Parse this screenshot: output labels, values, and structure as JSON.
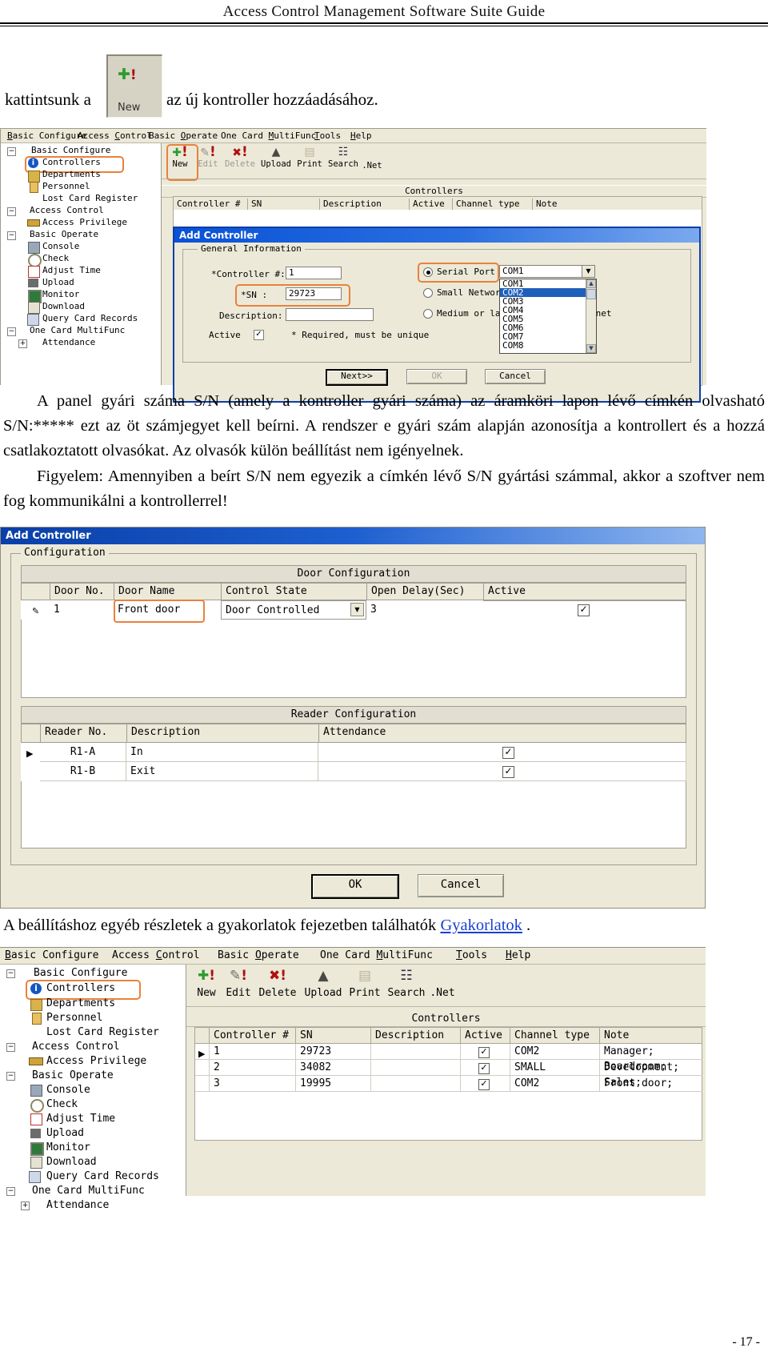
{
  "document": {
    "running_head": "Access Control Management Software Suite Guide",
    "page_number": "- 17 -"
  },
  "intro": {
    "before": "kattintsunk a",
    "after": "az új kontroller hozzáadásához.",
    "button_label": "New",
    "button_icon": "add-plus-icon"
  },
  "paragraphs": {
    "p1": "A panel gyári száma S/N (amely a kontroller gyári száma) az áramköri lapon lévő címkén olvasható S/N:***** ezt az öt számjegyet kell beírni. A rendszer e gyári szám alapján azonosítja a kontrollert és a hozzá csatlakoztatott olvasókat. Az olvasók külön beállítást nem igényelnek.",
    "p2": "Figyelem: Amennyiben a beírt S/N nem egyezik a címkén lévő S/N gyártási számmal, akkor a szoftver nem fog kommunikálni a kontrollerrel!"
  },
  "link_line": {
    "before": "A beállításhoz egyéb részletek a gyakorlatok fejezetben találhatók ",
    "link_text": "Gyakorlatok",
    "after": " ."
  },
  "app": {
    "menubar": [
      "Basic Configure",
      "Access Control",
      "Basic Operate",
      "One Card MultiFunc",
      "Tools",
      "Help"
    ],
    "toolbar": [
      {
        "label": "New",
        "icon": "add-plus-icon",
        "enabled": true
      },
      {
        "label": "Edit",
        "icon": "pencil-icon",
        "enabled": false
      },
      {
        "label": "Delete",
        "icon": "red-x-icon",
        "enabled": false
      },
      {
        "label": "Upload",
        "icon": "upload-icon",
        "enabled": true
      },
      {
        "label": "Print",
        "icon": "printer-icon",
        "enabled": true
      },
      {
        "label": "Search",
        "icon": "binoculars-icon",
        "enabled": true
      },
      {
        "label": ".Net",
        "icon": "network-icon",
        "enabled": true
      }
    ],
    "tree": [
      {
        "label": "Basic Configure",
        "level": 0,
        "expander": "-",
        "icon": "none"
      },
      {
        "label": "Controllers",
        "level": 1,
        "expander": "",
        "icon": "info-icon",
        "highlighted": true
      },
      {
        "label": "Departments",
        "level": 1,
        "expander": "",
        "icon": "people-icon"
      },
      {
        "label": "Personnel",
        "level": 1,
        "expander": "",
        "icon": "person-icon"
      },
      {
        "label": "Lost Card Register",
        "level": 1,
        "expander": "",
        "icon": "none"
      },
      {
        "label": "Access Control",
        "level": 0,
        "expander": "-",
        "icon": "none"
      },
      {
        "label": "Access Privilege",
        "level": 1,
        "expander": "",
        "icon": "key-icon"
      },
      {
        "label": "Basic Operate",
        "level": 0,
        "expander": "-",
        "icon": "none"
      },
      {
        "label": "Console",
        "level": 1,
        "expander": "",
        "icon": "console-icon"
      },
      {
        "label": "Check",
        "level": 1,
        "expander": "",
        "icon": "magnifier-icon"
      },
      {
        "label": "Adjust Time",
        "level": 1,
        "expander": "",
        "icon": "clock-icon"
      },
      {
        "label": "Upload",
        "level": 1,
        "expander": "",
        "icon": "upload-icon"
      },
      {
        "label": "Monitor",
        "level": 1,
        "expander": "",
        "icon": "monitor-icon"
      },
      {
        "label": "Download",
        "level": 1,
        "expander": "",
        "icon": "download-icon"
      },
      {
        "label": "Query Card Records",
        "level": 1,
        "expander": "",
        "icon": "card-records-icon"
      },
      {
        "label": "One Card MultiFunc",
        "level": 0,
        "expander": "-",
        "icon": "none"
      },
      {
        "label": "Attendance",
        "level": 1,
        "expander": "+",
        "icon": "none"
      }
    ],
    "grid_title": "Controllers",
    "grid_columns": [
      "Controller #",
      "SN",
      "Description",
      "Active",
      "Channel type",
      "Note"
    ],
    "grid_rows": [
      {
        "num": "1",
        "sn": "29723",
        "description": "",
        "active": true,
        "channel": "COM2",
        "note": "Manager;  Boardroom;"
      },
      {
        "num": "2",
        "sn": "34082",
        "description": "",
        "active": true,
        "channel": "SMALL",
        "note": "Development;  Sales;"
      },
      {
        "num": "3",
        "sn": "19995",
        "description": "",
        "active": true,
        "channel": "COM2",
        "note": "Front door;"
      }
    ]
  },
  "add_controller_step1": {
    "title": "Add Controller",
    "group_label": "General Information",
    "fields": {
      "controller_no_label": "*Controller #:",
      "controller_no_value": "1",
      "sn_label": "*SN :",
      "sn_value": "29723",
      "description_label": "Description:",
      "description_value": "",
      "active_label": "Active",
      "active_checked": true,
      "required_note": "*  Required, must be unique"
    },
    "channel_options": [
      {
        "label": "Serial Port",
        "selected": true,
        "highlighted": true
      },
      {
        "label": "Small Network (LAN Network)",
        "selected": false
      },
      {
        "label": "Medium or large network, Internet",
        "selected": false
      }
    ],
    "combo_value": "COM1",
    "combo_list": [
      "COM1",
      "COM2",
      "COM3",
      "COM4",
      "COM5",
      "COM6",
      "COM7",
      "COM8"
    ],
    "combo_selected": "COM2",
    "buttons": [
      {
        "label": "Next>>",
        "state": "default"
      },
      {
        "label": "OK",
        "state": "disabled"
      },
      {
        "label": "Cancel",
        "state": "normal"
      }
    ]
  },
  "add_controller_step2": {
    "title": "Add Controller",
    "group_label": "Configuration",
    "door_section_title": "Door Configuration",
    "door_columns": [
      "Door No.",
      "Door Name",
      "Control State",
      "Open Delay(Sec)",
      "Active"
    ],
    "door_rows": [
      {
        "no": "1",
        "name": "Front door",
        "state": "Door Controlled",
        "delay": "3",
        "active": true,
        "name_highlighted": true
      }
    ],
    "reader_section_title": "Reader Configuration",
    "reader_columns": [
      "Reader No.",
      "Description",
      "Attendance"
    ],
    "reader_rows": [
      {
        "no": "R1-A",
        "description": "In",
        "attendance": true,
        "current": true
      },
      {
        "no": "R1-B",
        "description": "Exit",
        "attendance": true,
        "current": false
      }
    ],
    "buttons": [
      {
        "label": "OK",
        "state": "default"
      },
      {
        "label": "Cancel",
        "state": "normal"
      }
    ]
  },
  "colors": {
    "title_bar_blue": "#0a3fa8",
    "highlight_orange": "#e8823c",
    "window_face": "#ece9d8",
    "selection_blue": "#1e5fba",
    "link_blue": "#1a3fd0",
    "plus_green": "#2e9b2e",
    "delete_red": "#b01010"
  }
}
